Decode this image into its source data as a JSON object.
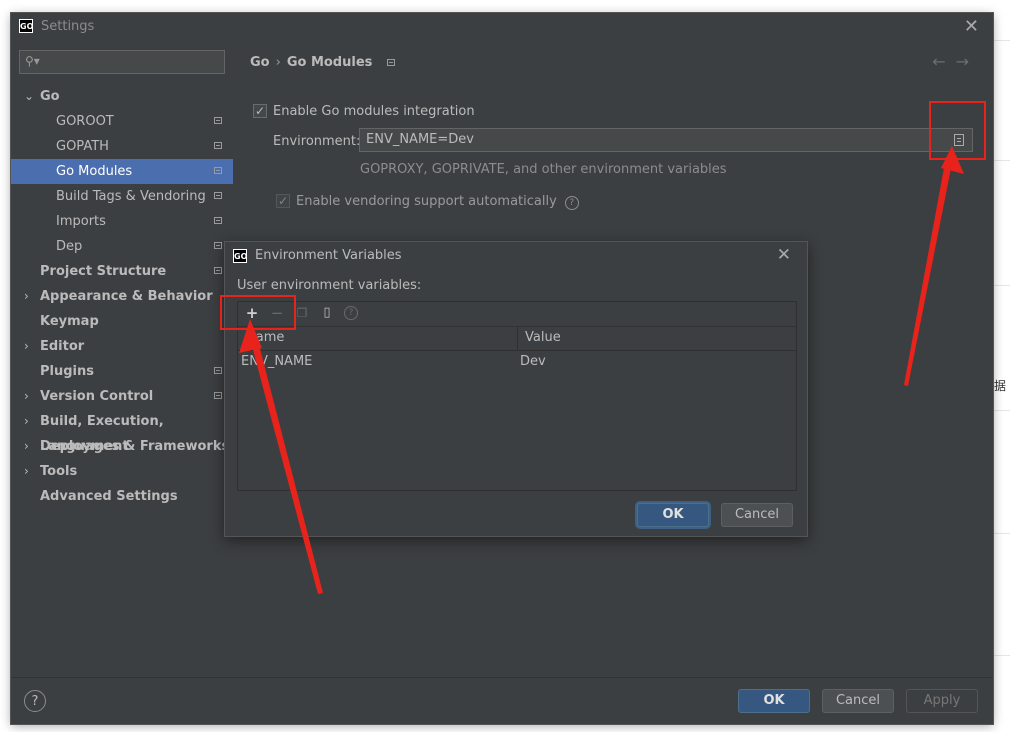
{
  "window": {
    "title": "Settings"
  },
  "sidebar": {
    "search_placeholder": "",
    "items": [
      {
        "label": "Go",
        "type": "group-open"
      },
      {
        "label": "GOROOT",
        "type": "child"
      },
      {
        "label": "GOPATH",
        "type": "child"
      },
      {
        "label": "Go Modules",
        "type": "child",
        "selected": true
      },
      {
        "label": "Build Tags & Vendoring",
        "type": "child"
      },
      {
        "label": "Imports",
        "type": "child"
      },
      {
        "label": "Dep",
        "type": "child"
      },
      {
        "label": "Project Structure",
        "type": "bold"
      },
      {
        "label": "Appearance & Behavior",
        "type": "group"
      },
      {
        "label": "Keymap",
        "type": "bold"
      },
      {
        "label": "Editor",
        "type": "group"
      },
      {
        "label": "Plugins",
        "type": "bold"
      },
      {
        "label": "Version Control",
        "type": "group"
      },
      {
        "label": "Build, Execution, Deployment",
        "type": "group"
      },
      {
        "label": "Languages & Frameworks",
        "type": "group"
      },
      {
        "label": "Tools",
        "type": "group"
      },
      {
        "label": "Advanced Settings",
        "type": "bold"
      }
    ]
  },
  "main": {
    "breadcrumb": [
      "Go",
      "Go Modules"
    ],
    "enable_modules_label": "Enable Go modules integration",
    "environment_label": "Environment:",
    "environment_value": "ENV_NAME=Dev",
    "environment_hint": "GOPROXY, GOPRIVATE, and other environment variables",
    "vendoring_label": "Enable vendoring support automatically"
  },
  "footer": {
    "ok": "OK",
    "cancel": "Cancel",
    "apply": "Apply"
  },
  "dialog": {
    "title": "Environment Variables",
    "subtitle": "User environment variables:",
    "columns": [
      "Name",
      "Value"
    ],
    "rows": [
      {
        "name": "ENV_NAME",
        "value": "Dev"
      }
    ],
    "ok": "OK",
    "cancel": "Cancel"
  },
  "background_fragments": {
    "right_char": "据"
  },
  "colors": {
    "annotation": "#e8231b",
    "accent": "#4b6eaf",
    "primary_button": "#365880"
  }
}
